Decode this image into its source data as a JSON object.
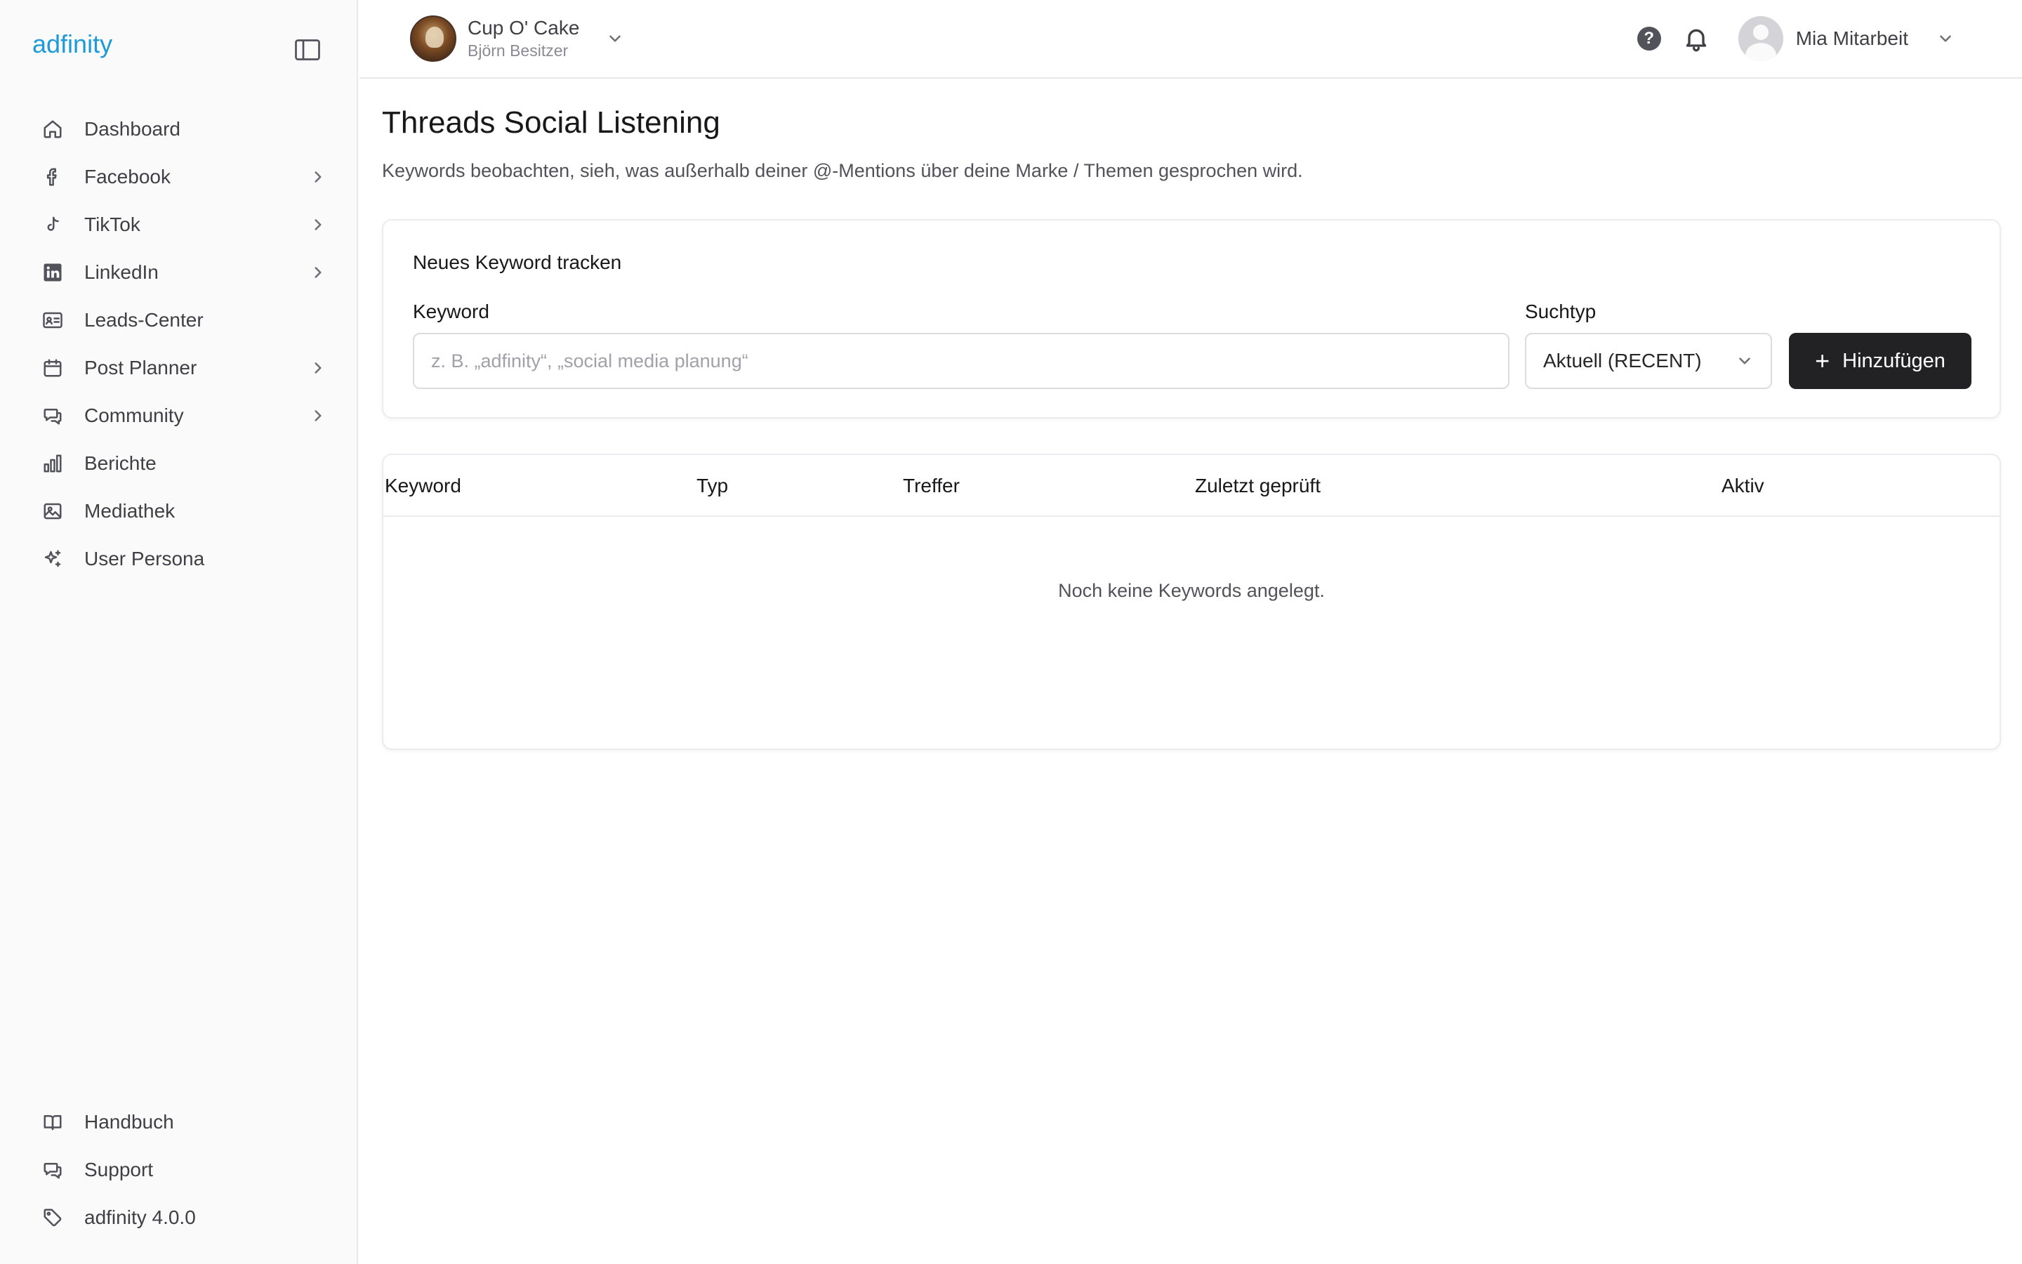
{
  "brand": {
    "logo_text": "adfinity"
  },
  "sidebar": {
    "items": [
      {
        "label": "Dashboard",
        "icon": "home-icon",
        "has_children": false
      },
      {
        "label": "Facebook",
        "icon": "facebook-icon",
        "has_children": true
      },
      {
        "label": "TikTok",
        "icon": "tiktok-icon",
        "has_children": true
      },
      {
        "label": "LinkedIn",
        "icon": "linkedin-icon",
        "has_children": true
      },
      {
        "label": "Leads-Center",
        "icon": "contact-card-icon",
        "has_children": false
      },
      {
        "label": "Post Planner",
        "icon": "calendar-icon",
        "has_children": true
      },
      {
        "label": "Community",
        "icon": "chat-icon",
        "has_children": true
      },
      {
        "label": "Berichte",
        "icon": "bar-chart-icon",
        "has_children": false
      },
      {
        "label": "Mediathek",
        "icon": "image-icon",
        "has_children": false
      },
      {
        "label": "User Persona",
        "icon": "sparkles-icon",
        "has_children": false
      }
    ],
    "bottom_items": [
      {
        "label": "Handbuch",
        "icon": "book-icon"
      },
      {
        "label": "Support",
        "icon": "chat-icon"
      },
      {
        "label": "adfinity 4.0.0",
        "icon": "tag-icon"
      }
    ]
  },
  "header": {
    "account_name": "Cup O' Cake",
    "account_role": "Björn Besitzer",
    "help_label": "?",
    "user_name": "Mia Mitarbeit"
  },
  "page": {
    "title": "Threads Social Listening",
    "subtitle": "Keywords beobachten, sieh, was außerhalb deiner @-Mentions über deine Marke / Themen gesprochen wird."
  },
  "form": {
    "title": "Neues Keyword tracken",
    "keyword_label": "Keyword",
    "keyword_placeholder": "z. B. „adfinity“, „social media planung“",
    "keyword_value": "",
    "type_label": "Suchtyp",
    "type_value": "Aktuell (RECENT)",
    "add_label": "Hinzufügen"
  },
  "table": {
    "columns": [
      "Keyword",
      "Typ",
      "Treffer",
      "Zuletzt geprüft",
      "Aktiv"
    ],
    "rows": [],
    "empty_message": "Noch keine Keywords angelegt."
  },
  "colors": {
    "logo_blue": "#1e9ad6",
    "primary_button": "#222224",
    "sidebar_bg": "#fafafa"
  }
}
